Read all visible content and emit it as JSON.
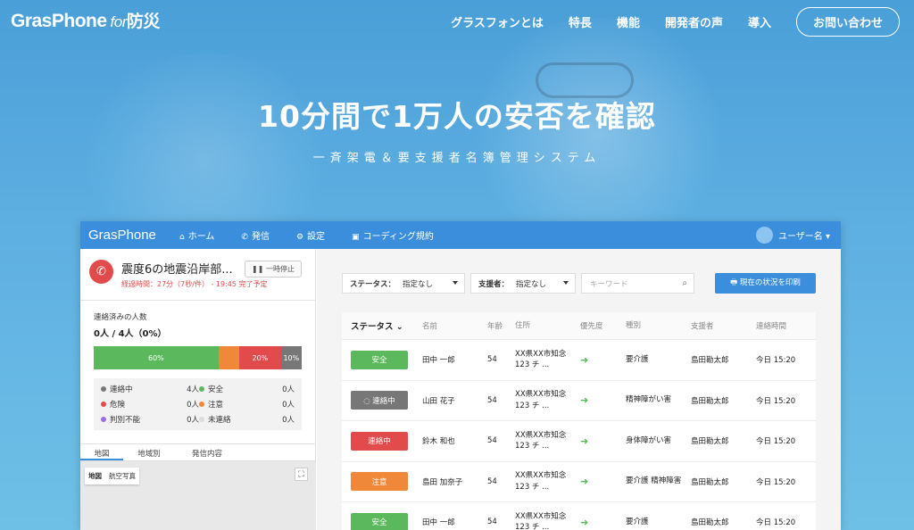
{
  "site": {
    "logo_main": "GrasPhone",
    "logo_for": "for",
    "logo_jp": "防災",
    "nav": [
      "グラスフォンとは",
      "特長",
      "機能",
      "開発者の声",
      "導入"
    ],
    "contact": "お問い合わせ"
  },
  "hero": {
    "title": "10分間で1万人の安否を確認",
    "subtitle": "一斉架電＆要支援者名簿管理システム"
  },
  "app": {
    "brand": "GrasPhone",
    "menu": [
      {
        "icon": "home-icon",
        "glyph": "⌂",
        "label": "ホーム"
      },
      {
        "icon": "phone-icon",
        "glyph": "✆",
        "label": "発信"
      },
      {
        "icon": "gear-icon",
        "glyph": "⚙",
        "label": "設定"
      },
      {
        "icon": "shield-icon",
        "glyph": "▣",
        "label": "コーディング規約"
      }
    ],
    "user": "ユーザー名 ▾",
    "call": {
      "title": "震度6の地震沿岸部...",
      "pause": "❚❚ 一時停止",
      "elapsed": "経過時間：27分（7秒/件） - 19:45 完了予定"
    },
    "stats": {
      "label": "連絡済みの人数",
      "value": "0人 / 4人（0%）",
      "bar": [
        {
          "pct": 60,
          "label": "60%",
          "color": "#5cb85c"
        },
        {
          "pct": 10,
          "label": "",
          "color": "#f0883a"
        },
        {
          "pct": 20,
          "label": "20%",
          "color": "#e24b4b"
        },
        {
          "pct": 10,
          "label": "10%",
          "color": "#777777"
        }
      ],
      "legend": [
        {
          "label": "連絡中",
          "count": "4人",
          "color": "#777777"
        },
        {
          "label": "安全",
          "count": "0人",
          "color": "#5cb85c"
        },
        {
          "label": "危険",
          "count": "0人",
          "color": "#e24b4b"
        },
        {
          "label": "注意",
          "count": "0人",
          "color": "#f0883a"
        },
        {
          "label": "判別不能",
          "count": "0人",
          "color": "#9b6fe0"
        },
        {
          "label": "未連絡",
          "count": "0人",
          "color": "#dddddd"
        }
      ]
    },
    "tabs": [
      "地図",
      "地域別",
      "発信内容"
    ],
    "map": {
      "map_label": "地図",
      "aerial_label": "航空写真",
      "fullscreen": "⛶"
    },
    "filters": {
      "status_label": "ステータス：",
      "status_value": "指定なし",
      "supporter_label": "支援者：",
      "supporter_value": "指定なし",
      "keyword_placeholder": "キーワード"
    },
    "print_button": "🖶 現在の状況を印刷",
    "table": {
      "headers": [
        "ステータス ⌄",
        "名前",
        "年齢",
        "住所",
        "優先度",
        "種別",
        "支援者",
        "連絡時間"
      ],
      "rows": [
        {
          "status": "安全",
          "status_color": "#5cb85c",
          "name": "田中 一郎",
          "age": "54",
          "address": "XX県XX市知念123 チ ...",
          "priority": "➜",
          "type": "要介護",
          "supporter": "島田勘太郎",
          "time": "今日 15:20"
        },
        {
          "status": "◌ 連絡中",
          "status_color": "#777777",
          "name": "山田 花子",
          "age": "54",
          "address": "XX県XX市知念123 チ ...",
          "priority": "➜",
          "type": "精神障がい害",
          "supporter": "島田勘太郎",
          "time": "今日 15:20"
        },
        {
          "status": "連絡中",
          "status_color": "#e24b4b",
          "name": "鈴木 和也",
          "age": "54",
          "address": "XX県XX市知念123 チ ...",
          "priority": "➜",
          "type": "身体障がい害",
          "supporter": "島田勘太郎",
          "time": "今日 15:20"
        },
        {
          "status": "注意",
          "status_color": "#f0883a",
          "name": "島田 加奈子",
          "age": "54",
          "address": "XX県XX市知念123 チ ...",
          "priority": "➜",
          "type": "要介護 精神障害",
          "supporter": "島田勘太郎",
          "time": "今日 15:20"
        },
        {
          "status": "安全",
          "status_color": "#5cb85c",
          "name": "田中 一郎",
          "age": "54",
          "address": "XX県XX市知念123 チ ...",
          "priority": "➜",
          "type": "要介護",
          "supporter": "島田勘太郎",
          "time": "今日 15:20"
        }
      ]
    }
  }
}
